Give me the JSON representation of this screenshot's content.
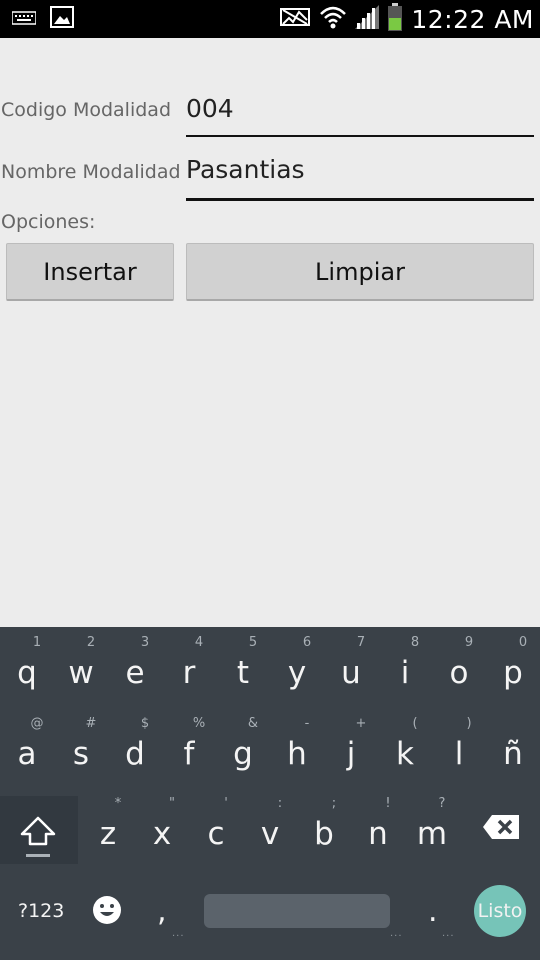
{
  "status_bar": {
    "time": "12:22 AM",
    "icons": [
      "keyboard-icon",
      "image-icon",
      "mute-icon",
      "wifi-icon",
      "signal-icon",
      "battery-icon"
    ]
  },
  "form": {
    "codigo_label": "Codigo Modalidad",
    "codigo_value": "004",
    "nombre_label": "Nombre Modalidad",
    "nombre_value": "Pasantias",
    "opciones_label": "Opciones:",
    "insertar_label": "Insertar",
    "limpiar_label": "Limpiar"
  },
  "keyboard": {
    "row1": [
      {
        "k": "q",
        "h": "1"
      },
      {
        "k": "w",
        "h": "2"
      },
      {
        "k": "e",
        "h": "3"
      },
      {
        "k": "r",
        "h": "4"
      },
      {
        "k": "t",
        "h": "5"
      },
      {
        "k": "y",
        "h": "6"
      },
      {
        "k": "u",
        "h": "7"
      },
      {
        "k": "i",
        "h": "8"
      },
      {
        "k": "o",
        "h": "9"
      },
      {
        "k": "p",
        "h": "0"
      }
    ],
    "row2": [
      {
        "k": "a",
        "h": "@"
      },
      {
        "k": "s",
        "h": "#"
      },
      {
        "k": "d",
        "h": "$"
      },
      {
        "k": "f",
        "h": "%"
      },
      {
        "k": "g",
        "h": "&"
      },
      {
        "k": "h",
        "h": "-"
      },
      {
        "k": "j",
        "h": "+"
      },
      {
        "k": "k",
        "h": "("
      },
      {
        "k": "l",
        "h": ")"
      },
      {
        "k": "ñ",
        "h": ""
      }
    ],
    "row3": [
      {
        "k": "z",
        "h": "*"
      },
      {
        "k": "x",
        "h": "\""
      },
      {
        "k": "c",
        "h": "'"
      },
      {
        "k": "v",
        "h": ":"
      },
      {
        "k": "b",
        "h": ";"
      },
      {
        "k": "n",
        "h": "!"
      },
      {
        "k": "m",
        "h": "?"
      }
    ],
    "sym_label": "?123",
    "comma": ",",
    "period": ".",
    "done_label": "Listo",
    "dots": "..."
  },
  "colors": {
    "background": "#ececec",
    "keyboard": "#3a4148",
    "done_key": "#76c4b8"
  }
}
